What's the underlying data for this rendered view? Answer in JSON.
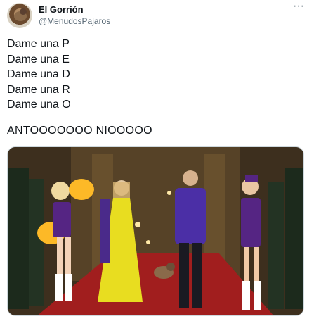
{
  "author": {
    "display_name": "El Gorrión",
    "handle": "@MenudosPajaros",
    "avatar_icon": "sparrow-avatar"
  },
  "menu": {
    "more_label": "···"
  },
  "tweet": {
    "lines": [
      "Dame una P",
      "Dame una E",
      "Dame una D",
      "Dame una R",
      "Dame una O"
    ],
    "shout": "ANTOOOOOOO NIOOOOO"
  },
  "media": {
    "kind": "photo-meme",
    "colors": {
      "carpet": "#a11e1e",
      "lakers_purple": "#552583",
      "lakers_gold": "#fdb927",
      "dress_yellow": "#e8dd20"
    }
  }
}
